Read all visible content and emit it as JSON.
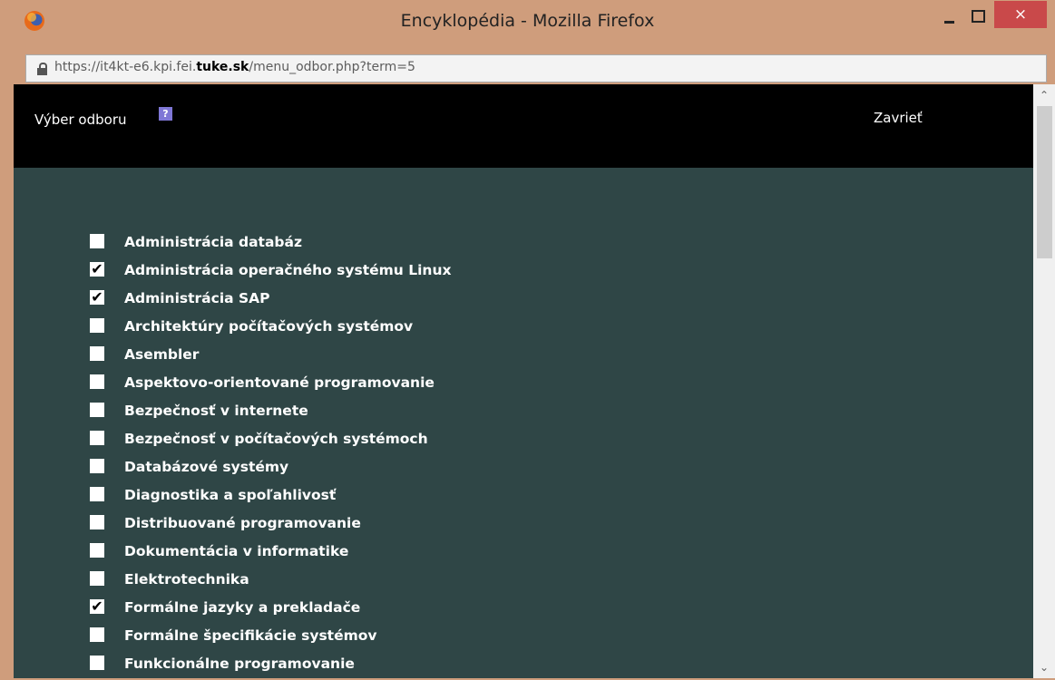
{
  "window": {
    "title": "Encyklopédia - Mozilla Firefox",
    "close_symbol": "×"
  },
  "urlbar": {
    "url_prefix": "https://it4kt-e6.kpi.fei.",
    "url_domain": "tuke.sk",
    "url_suffix": "/menu_odbor.php?term=5"
  },
  "header": {
    "title": "Výber odboru",
    "help_symbol": "?",
    "close_label": "Zavrieť"
  },
  "items": [
    {
      "label": "Administrácia databáz",
      "checked": false
    },
    {
      "label": "Administrácia operačného systému Linux",
      "checked": true
    },
    {
      "label": "Administrácia SAP",
      "checked": true
    },
    {
      "label": "Architektúry počítačových systémov",
      "checked": false
    },
    {
      "label": "Asembler",
      "checked": false
    },
    {
      "label": "Aspektovo-orientované programovanie",
      "checked": false
    },
    {
      "label": "Bezpečnosť v internete",
      "checked": false
    },
    {
      "label": "Bezpečnosť v počítačových systémoch",
      "checked": false
    },
    {
      "label": "Databázové systémy",
      "checked": false
    },
    {
      "label": "Diagnostika a spoľahlivosť",
      "checked": false
    },
    {
      "label": "Distribuované programovanie",
      "checked": false
    },
    {
      "label": "Dokumentácia v informatike",
      "checked": false
    },
    {
      "label": "Elektrotechnika",
      "checked": false
    },
    {
      "label": "Formálne jazyky a prekladače",
      "checked": true
    },
    {
      "label": "Formálne špecifikácie systémov",
      "checked": false
    },
    {
      "label": "Funkcionálne programovanie",
      "checked": false
    }
  ],
  "colors": {
    "window_frame": "#cf9d7c",
    "page_background": "#2f4646",
    "header_background": "#000000",
    "close_button": "#c9494a"
  }
}
